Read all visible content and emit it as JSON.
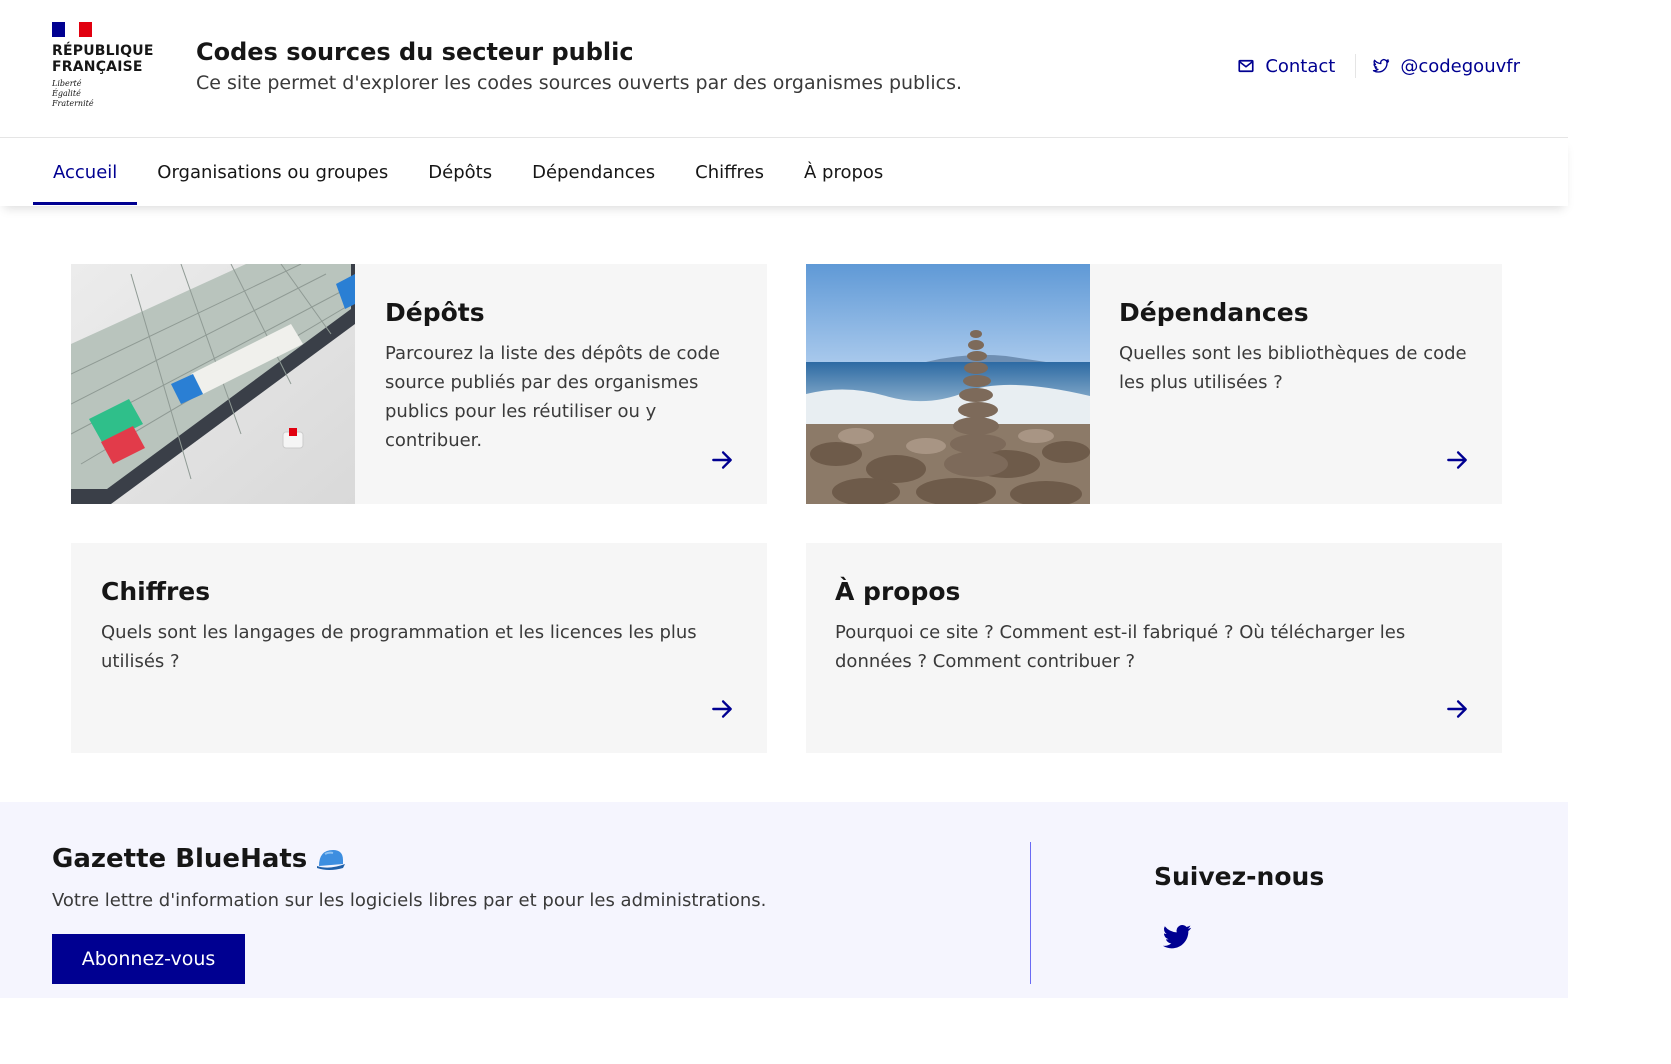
{
  "header": {
    "logo_title": "RÉPUBLIQUE\nFRANÇAISE",
    "motto": "Liberté\nÉgalité\nFraternité",
    "site_title": "Codes sources du secteur public",
    "site_tagline": "Ce site permet d'explorer les codes sources ouverts par des organismes publics.",
    "contact_label": "Contact",
    "twitter_label": "@codegouvfr"
  },
  "nav": {
    "items": [
      {
        "label": "Accueil",
        "active": true
      },
      {
        "label": "Organisations ou groupes"
      },
      {
        "label": "Dépôts"
      },
      {
        "label": "Dépendances"
      },
      {
        "label": "Chiffres"
      },
      {
        "label": "À propos"
      }
    ]
  },
  "cards": [
    {
      "title": "Dépôts",
      "description": "Parcourez la liste des dépôts de code source publiés par des organismes publics pour les réutiliser ou y contribuer.",
      "image": "keyboard-photo"
    },
    {
      "title": "Dépendances",
      "description": "Quelles sont les bibliothèques de code les plus utilisées ?",
      "image": "stacked-stones-photo"
    },
    {
      "title": "Chiffres",
      "description": "Quels sont les langages de programmation et les licences les plus utilisés ?"
    },
    {
      "title": "À propos",
      "description": "Pourquoi ce site ? Comment est-il fabriqué ? Où télécharger les données ? Comment contribuer ?"
    }
  ],
  "footer": {
    "gazette_title": "Gazette BlueHats",
    "gazette_text": "Votre lettre d'information sur les logiciels libres par et pour les administrations.",
    "subscribe_label": "Abonnez-vous",
    "follow_title": "Suivez-nous"
  },
  "colors": {
    "primary": "#000091",
    "card_bg": "#f6f6f6",
    "footer_bg": "#f5f5fe",
    "marianne_red": "#e1000f"
  },
  "icons": [
    "mail-icon",
    "twitter-icon",
    "arrow-right-icon",
    "bluehat-cap-icon"
  ]
}
